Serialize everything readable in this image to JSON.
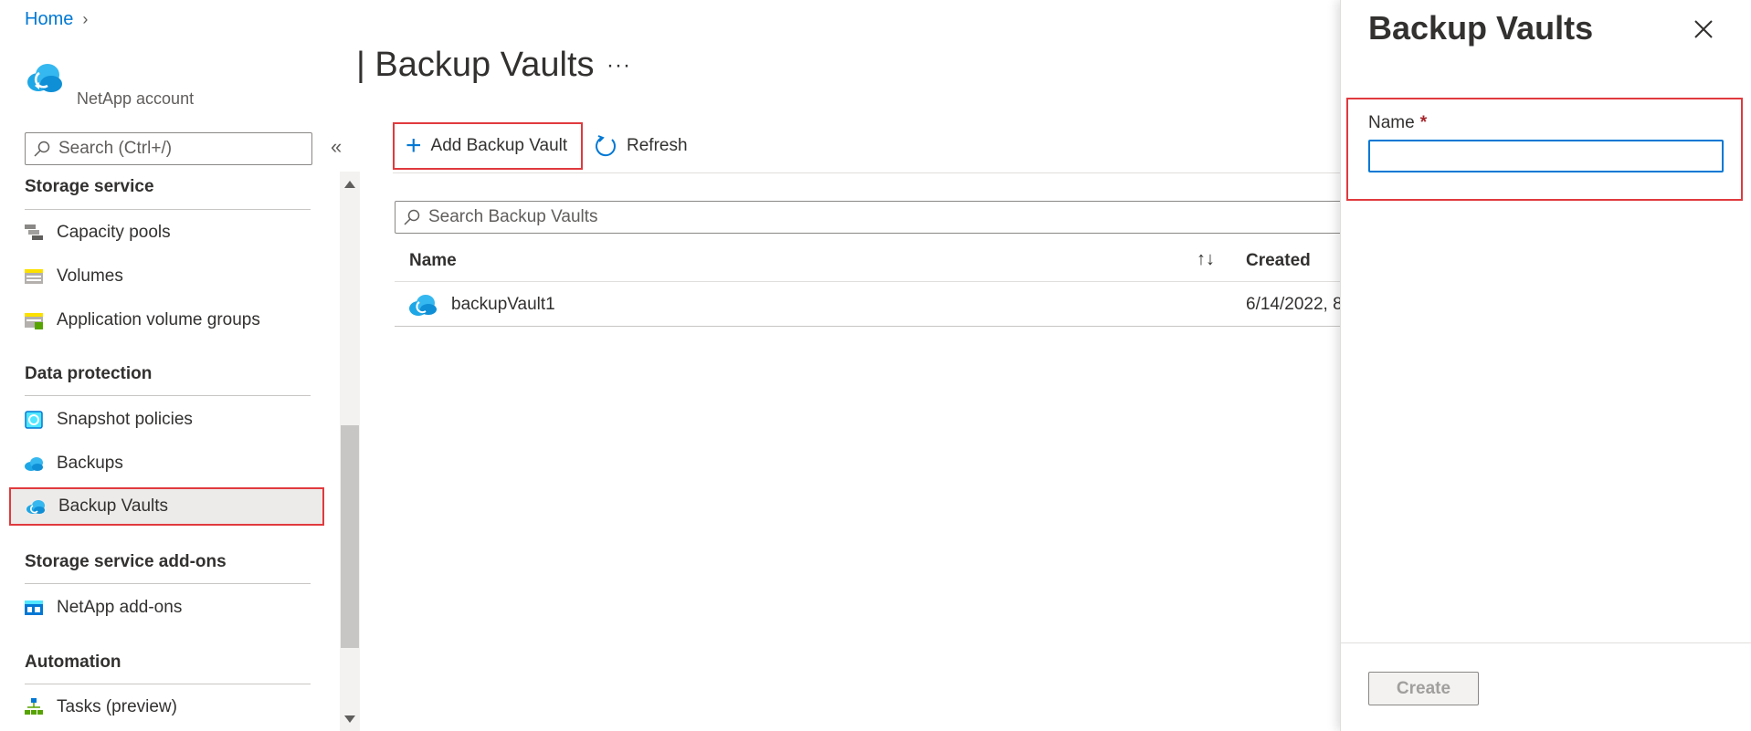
{
  "breadcrumb": {
    "home": "Home"
  },
  "header": {
    "resource_type": "NetApp account",
    "page_title": "| Backup Vaults",
    "more_label": "···"
  },
  "sidebar": {
    "search_placeholder": "Search (Ctrl+/)",
    "collapse_label": "«",
    "sections": {
      "storage_service": "Storage service",
      "data_protection": "Data protection",
      "addons": "Storage service add-ons",
      "automation": "Automation"
    },
    "items": {
      "capacity_pools": "Capacity pools",
      "volumes": "Volumes",
      "app_volume_groups": "Application volume groups",
      "snapshot_policies": "Snapshot policies",
      "backups": "Backups",
      "backup_vaults": "Backup Vaults",
      "netapp_addons": "NetApp add-ons",
      "tasks": "Tasks (preview)"
    },
    "selected": "Backup Vaults"
  },
  "toolbar": {
    "add_label": "Add Backup Vault",
    "refresh_label": "Refresh"
  },
  "grid": {
    "search_placeholder": "Search Backup Vaults",
    "columns": {
      "name": "Name",
      "created": "Created"
    },
    "sort_icon": "↑↓",
    "rows": [
      {
        "name": "backupVault1",
        "created": "6/14/2022, 8"
      }
    ]
  },
  "panel": {
    "title": "Backup Vaults",
    "name_label": "Name",
    "required_marker": "*",
    "name_value": "",
    "create_label": "Create"
  },
  "colors": {
    "accent": "#0078d4",
    "highlight": "#e03a3e",
    "selected_bg": "#edebe9"
  }
}
